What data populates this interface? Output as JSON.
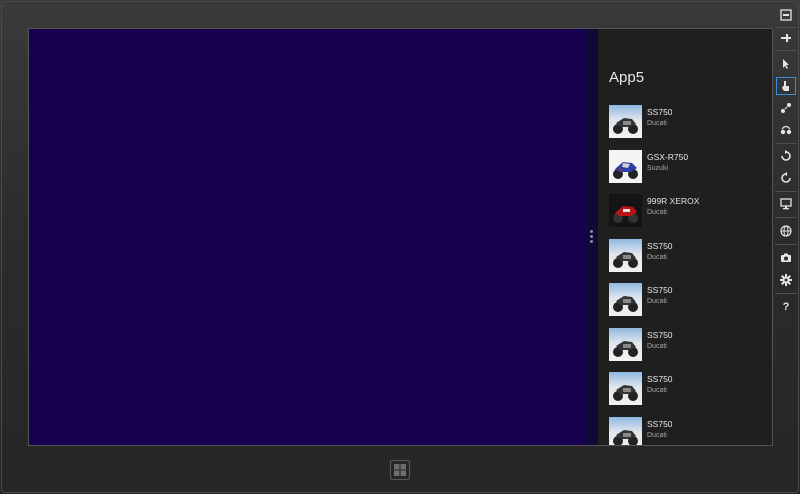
{
  "snapped_app": {
    "title": "App5",
    "items": [
      {
        "title": "SS750",
        "subtitle": "Ducati",
        "thumb": "ducati-ss750-photo"
      },
      {
        "title": "GSX-R750",
        "subtitle": "Suzuki",
        "thumb": "suzuki-gsxr750-photo"
      },
      {
        "title": "999R XEROX",
        "subtitle": "Ducati",
        "thumb": "ducati-999r-photo"
      },
      {
        "title": "SS750",
        "subtitle": "Ducati",
        "thumb": "ducati-ss750-photo"
      },
      {
        "title": "SS750",
        "subtitle": "Ducati",
        "thumb": "ducati-ss750-photo"
      },
      {
        "title": "SS750",
        "subtitle": "Ducati",
        "thumb": "ducati-ss750-photo"
      },
      {
        "title": "SS750",
        "subtitle": "Ducati",
        "thumb": "ducati-ss750-photo"
      },
      {
        "title": "SS750",
        "subtitle": "Ducati",
        "thumb": "ducati-ss750-photo"
      }
    ]
  },
  "simulator_toolbar": {
    "help_label": "?",
    "icons": [
      "minimize-icon",
      "pin-icon",
      "mouse-mode-icon",
      "touch-mode-icon",
      "pinch-zoom-icon",
      "rotate-touch-icon",
      "rotate-clockwise-icon",
      "rotate-counterclockwise-icon",
      "change-resolution-icon",
      "set-location-icon",
      "screenshot-icon",
      "settings-icon",
      "help-icon"
    ]
  },
  "colors": {
    "main_app_background": "#160050",
    "snapped_background": "#1f1f1f",
    "active_tool_border": "#3b8edb"
  }
}
